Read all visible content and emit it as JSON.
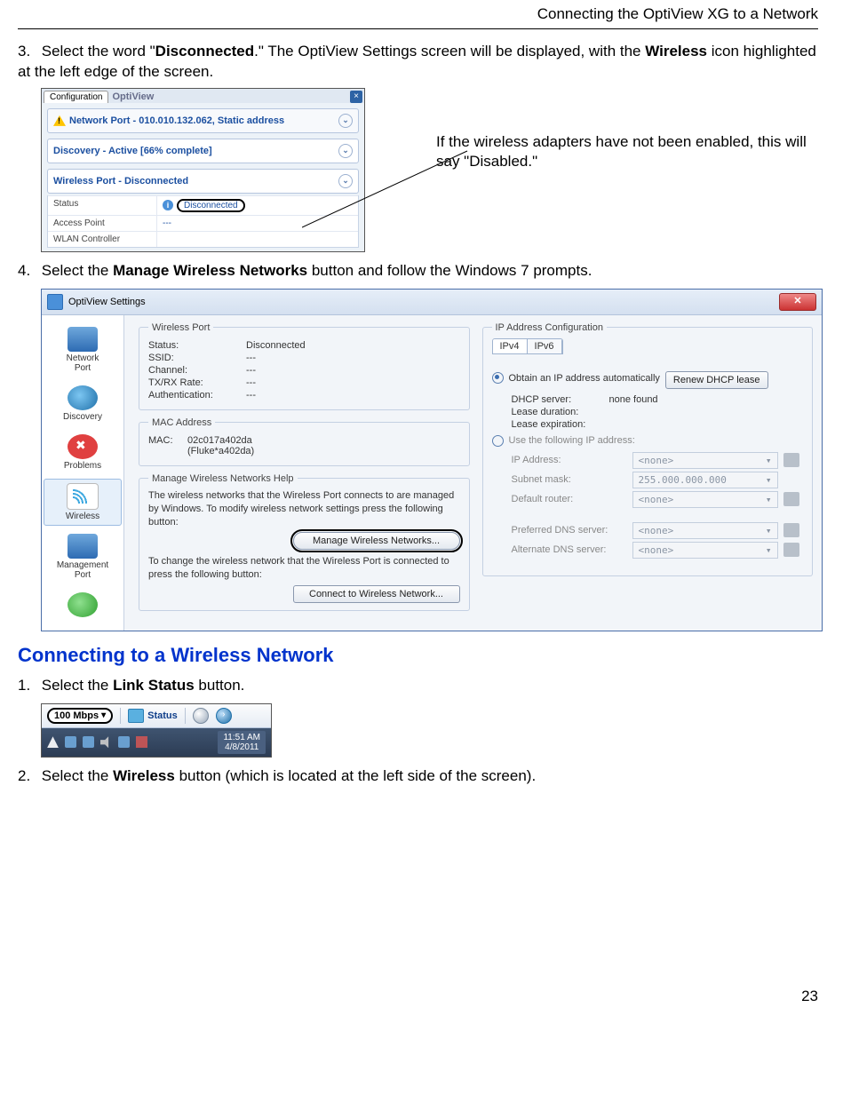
{
  "header": {
    "title": "Connecting the OptiView XG to a Network"
  },
  "step3": {
    "prefix": "3.",
    "t1": "Select the word \"",
    "bold1": "Disconnected",
    "t2": ".\" The OptiView Settings screen will be displayed, with the ",
    "bold2": "Wireless",
    "t3": " icon highlighted at the left edge of the screen."
  },
  "shot1": {
    "tab1": "Configuration",
    "tab2": "OptiView",
    "row1": "Network Port - 010.010.132.062, Static address",
    "row2": "Discovery - Active [66% complete]",
    "row3": "Wireless Port - Disconnected",
    "k_status": "Status",
    "v_status": "Disconnected",
    "k_ap": "Access Point",
    "v_ap": "---",
    "k_wlan": "WLAN Controller"
  },
  "callout1": "If the wireless adapters have not been enabled, this will say \"Disabled.\"",
  "step4": {
    "prefix": "4.",
    "t1": "Select the ",
    "bold1": "Manage Wireless Networks",
    "t2": " button and follow the Windows 7 prompts."
  },
  "shot2": {
    "title": "OptiView Settings",
    "side": {
      "net": "Network\nPort",
      "disc": "Discovery",
      "prob": "Problems",
      "wifi": "Wireless",
      "mgmt": "Management\nPort"
    },
    "wp_legend": "Wireless Port",
    "wp": {
      "status_k": "Status:",
      "status_v": "Disconnected",
      "ssid_k": "SSID:",
      "ssid_v": "---",
      "chan_k": "Channel:",
      "chan_v": "---",
      "rate_k": "TX/RX Rate:",
      "rate_v": "---",
      "auth_k": "Authentication:",
      "auth_v": "---"
    },
    "mac_legend": "MAC Address",
    "mac_k": "MAC:",
    "mac_v1": "02c017a402da",
    "mac_v2": "(Fluke*a402da)",
    "help_legend": "Manage Wireless Networks Help",
    "help1": "The wireless networks that the Wireless Port connects to are managed by Windows. To modify wireless network settings press the following button:",
    "btn_manage": "Manage Wireless Networks...",
    "help2": "To change the wireless network that the Wireless Port is connected to press the following button:",
    "btn_connect": "Connect to Wireless Network...",
    "ip_legend": "IP Address Configuration",
    "tab_v4": "IPv4",
    "tab_v6": "IPv6",
    "r_auto": "Obtain an IP address automatically",
    "btn_renew": "Renew DHCP lease",
    "dhcp_k": "DHCP server:",
    "dhcp_v": "none found",
    "leased_k": "Lease duration:",
    "leasee_k": "Lease expiration:",
    "r_static": "Use the following IP address:",
    "f_ip": "IP Address:",
    "f_ip_v": "<none>",
    "f_mask": "Subnet mask:",
    "f_mask_v": "255.000.000.000",
    "f_gw": "Default router:",
    "f_gw_v": "<none>",
    "f_dns1": "Preferred DNS server:",
    "f_dns1_v": "<none>",
    "f_dns2": "Alternate DNS server:",
    "f_dns2_v": "<none>"
  },
  "section": "Connecting to a Wireless Network",
  "step1b": {
    "prefix": "1.",
    "t1": "Select the ",
    "bold": "Link Status",
    "t2": " button."
  },
  "shot3": {
    "speed": "100",
    "unit": "Mbps",
    "status": "Status",
    "time": "11:51 AM",
    "date": "4/8/2011"
  },
  "step2b": {
    "prefix": "2.",
    "t1": "Select the ",
    "bold": "Wireless",
    "t2": " button (which is located at the left side of the screen)."
  },
  "pagenum": "23"
}
